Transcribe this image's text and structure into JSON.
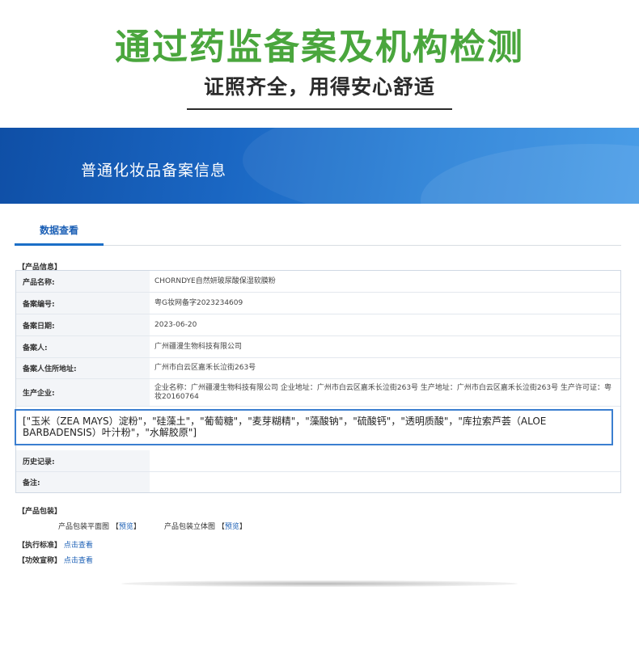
{
  "header": {
    "main_title": "通过药监备案及机构检测",
    "sub_title": "证照齐全，用得安心舒适"
  },
  "banner": {
    "title": "普通化妆品备案信息"
  },
  "tabs": {
    "active": "数据查看"
  },
  "product_info": {
    "section_label": "【产品信息】",
    "rows": [
      {
        "label": "产品名称:",
        "value": "CHORNDYE自然妍玻尿酸保湿软膜粉"
      },
      {
        "label": "备案编号:",
        "value": "粤G妆网备字2023234609"
      },
      {
        "label": "备案日期:",
        "value": "2023-06-20"
      },
      {
        "label": "备案人:",
        "value": "广州疆漫生物科技有限公司"
      },
      {
        "label": "备案人住所地址:",
        "value": "广州市白云区嘉禾长泣街263号"
      },
      {
        "label": "生产企业:",
        "value": "企业名称：广州疆漫生物科技有限公司 企业地址：广州市白云区嘉禾长泣街263号 生产地址：广州市白云区嘉禾长泣街263号 生产许可证：粤妆20160764"
      },
      {
        "label": "历史记录:",
        "value": ""
      },
      {
        "label": "备注:",
        "value": ""
      }
    ]
  },
  "ingredients_overlay": "[\"玉米（ZEA MAYS）淀粉\"，\"硅藻土\"，\"葡萄糖\"，\"麦芽糊精\"，\"藻酸钠\"，\"硫酸钙\"，\"透明质酸\"，\"库拉索芦荟（ALOE BARBADENSIS）叶汁粉\"，\"水解胶原\"]",
  "packaging": {
    "section_label": "【产品包装】",
    "flat_label": "产品包装平面图",
    "solid_label": "产品包装立体图",
    "bracket_open": "【",
    "bracket_close": "】",
    "preview": "预览"
  },
  "standard": {
    "label": "【执行标准】",
    "link": "点击查看"
  },
  "efficacy": {
    "label": "【功效宣称】",
    "link": "点击查看"
  }
}
